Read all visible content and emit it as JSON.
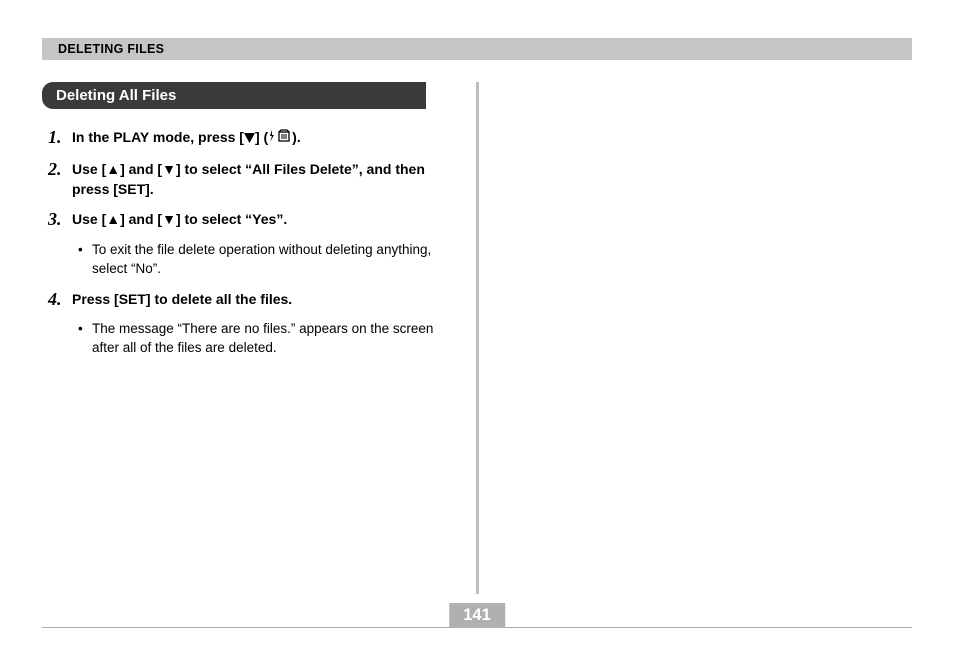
{
  "header": "DELETING FILES",
  "subheading": "Deleting All Files",
  "steps": [
    {
      "num": "1.",
      "text_before": "In the PLAY mode, press [",
      "text_mid": "] (",
      "text_after": ").",
      "notes": []
    },
    {
      "num": "2.",
      "text": "Use [▲] and [▼] to select “All Files Delete”, and then press [SET].",
      "notes": []
    },
    {
      "num": "3.",
      "text": "Use [▲] and [▼] to select “Yes”.",
      "notes": [
        "To exit the file delete operation without deleting anything, select “No”."
      ]
    },
    {
      "num": "4.",
      "text": "Press [SET] to delete all the files.",
      "notes": [
        "The message “There are no files.” appears on the screen after all of the files are deleted."
      ]
    }
  ],
  "page_number": "141"
}
